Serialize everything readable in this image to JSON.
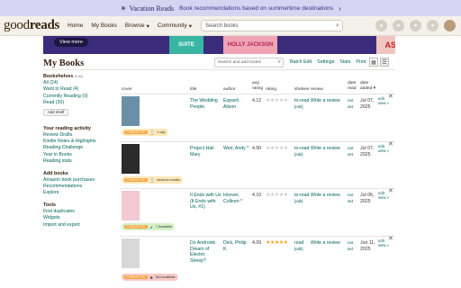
{
  "banner": {
    "brand": "Vacation Reads",
    "text": "Book recommendations based on summertime destinations"
  },
  "nav": {
    "logo_light": "good",
    "logo_bold": "reads",
    "home": "Home",
    "my_books": "My Books",
    "browse": "Browse",
    "community": "Community",
    "search_placeholder": "Search books"
  },
  "ad": {
    "pill": "View more",
    "book1": "SUITE",
    "book2": "HOLLY JACKSON",
    "book3": "ASHES"
  },
  "page": {
    "title": "My Books",
    "search_placeholder": "Search and add books"
  },
  "toolbar": {
    "batch_edit": "Batch Edit",
    "settings": "Settings",
    "stats": "Stats",
    "print": "Print"
  },
  "sidebar": {
    "bookshelves_label": "Bookshelves",
    "bookshelves_edit": "(Edit)",
    "shelves": [
      "All (24)",
      "Want to Read (4)",
      "Currently Reading (0)",
      "Read (20)"
    ],
    "add_shelf": "Add shelf",
    "activity_label": "Your reading activity",
    "activity": [
      "Review Drafts",
      "Kindle Notes & Highlights",
      "Reading Challenge",
      "Year in Books",
      "Reading stats"
    ],
    "add_books_label": "Add books",
    "add_books": [
      "Amazon book purchases",
      "Recommendations",
      "Explore"
    ],
    "tools_label": "Tools",
    "tools": [
      "Find duplicates",
      "Widgets",
      "Import and export"
    ]
  },
  "table": {
    "headers": {
      "cover": "cover",
      "title": "title",
      "author": "author",
      "avg": "avg",
      "rating_avg": "rating",
      "rating": "rating",
      "shelves": "shelves",
      "review": "review",
      "date": "date",
      "read": "read",
      "date2": "date",
      "added": "added ▾"
    },
    "rows": [
      {
        "title": "The Wedding People",
        "author": "Espach, Alison",
        "avg": "4.12",
        "my_stars": 0,
        "shelf": "to-read",
        "shelf_edit": "[edit]",
        "review": "Write a review",
        "date_read": "not set",
        "date_added": "Jul 07, 2025",
        "edit": "edit",
        "view": "view »",
        "badge_tag": "FORMATTED",
        "badge_text": "1 day",
        "badge_bg": "#fde9b8",
        "cover_color": "#6b8fa6"
      },
      {
        "title": "Project Hail Mary",
        "author": "Weir, Andy *",
        "avg": "4.50",
        "my_stars": 0,
        "shelf": "to-read",
        "shelf_edit": "[edit]",
        "review": "Write a review",
        "date_read": "not set",
        "date_added": "Jul 07, 2025",
        "edit": "edit",
        "view": "view »",
        "badge_tag": "FORMATTED",
        "badge_text": "several months",
        "badge_bg": "#fde9b8",
        "cover_color": "#2b2b2b"
      },
      {
        "title": "It Ends with Us (It Ends with Us, #1)",
        "author": "Hoover, Colleen *",
        "avg": "4.10",
        "my_stars": 0,
        "shelf": "to-read",
        "shelf_edit": "[edit]",
        "review": "Write a review",
        "date_read": "not set",
        "date_added": "Jul 06, 2025",
        "edit": "edit",
        "view": "view »",
        "badge_tag": "FORMATTED",
        "badge_text": "7 Available",
        "badge_bg": "#d5f0c8",
        "cover_color": "#f3c9d3"
      },
      {
        "title": "Do Androids Dream of Electric Sheep?",
        "author": "Dick, Philip K.",
        "avg": "4.09",
        "my_stars": 5,
        "shelf": "read",
        "shelf_edit": "[edit]",
        "review": "Write a review",
        "date_read": "not set",
        "date_added": "Jun 11, 2025",
        "edit": "edit",
        "view": "view »",
        "badge_tag": "FORMATTED",
        "badge_text": "Not available",
        "badge_bg": "#f9c9c9",
        "cover_color": "#d8d8d8"
      }
    ]
  }
}
